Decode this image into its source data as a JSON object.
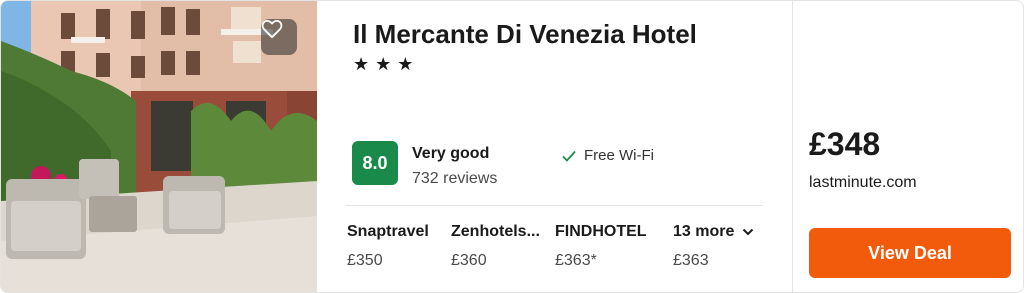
{
  "hotel": {
    "name": "Il Mercante Di Venezia Hotel",
    "stars": "★★★"
  },
  "rating": {
    "score": "8.0",
    "label": "Very good",
    "reviews": "732 reviews",
    "color": "#1a8a4a"
  },
  "amenity": {
    "icon": "check-icon",
    "label": "Free Wi-Fi"
  },
  "providers": [
    {
      "name": "Snaptravel",
      "price": "£350"
    },
    {
      "name": "Zenhotels...",
      "price": "£360"
    },
    {
      "name": "FINDHOTEL",
      "price": "£363*"
    }
  ],
  "more": {
    "label": "13 more",
    "price": "£363"
  },
  "deal": {
    "price": "£348",
    "site": "lastminute.com",
    "button_label": "View Deal",
    "button_color": "#f25a0c"
  },
  "photo": {
    "favorite_icon": "heart-icon"
  }
}
